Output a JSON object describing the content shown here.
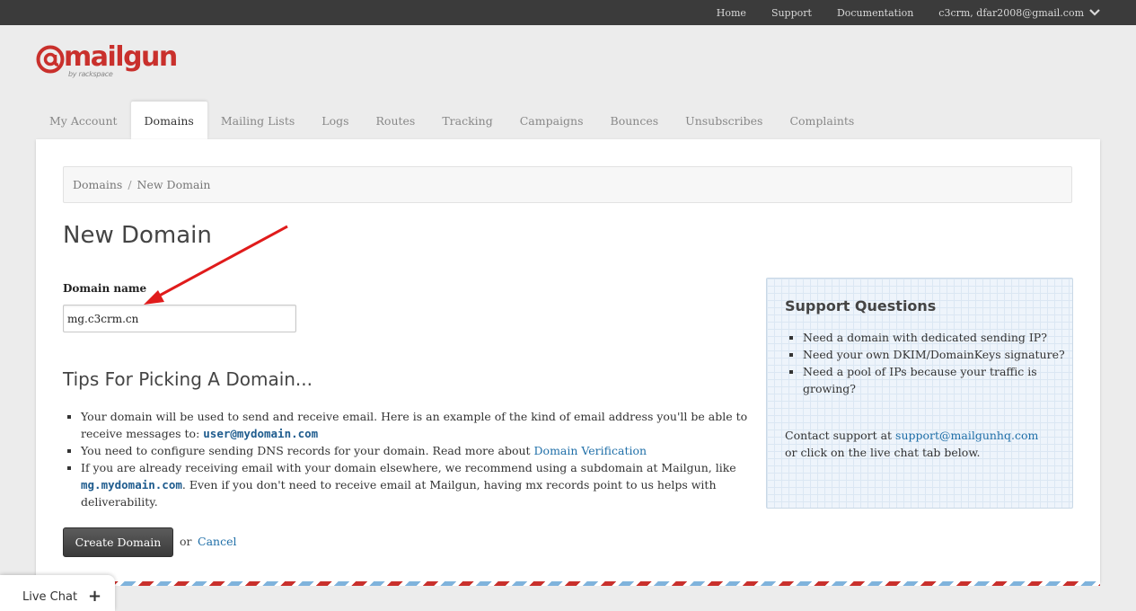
{
  "topnav": {
    "home": "Home",
    "support": "Support",
    "documentation": "Documentation",
    "account": "c3crm, dfar2008@gmail.com"
  },
  "logo": {
    "word": "mailgun",
    "sub": "by rackspace"
  },
  "tabs": [
    {
      "label": "My Account",
      "active": false
    },
    {
      "label": "Domains",
      "active": true
    },
    {
      "label": "Mailing Lists",
      "active": false
    },
    {
      "label": "Logs",
      "active": false
    },
    {
      "label": "Routes",
      "active": false
    },
    {
      "label": "Tracking",
      "active": false
    },
    {
      "label": "Campaigns",
      "active": false
    },
    {
      "label": "Bounces",
      "active": false
    },
    {
      "label": "Unsubscribes",
      "active": false
    },
    {
      "label": "Complaints",
      "active": false
    }
  ],
  "breadcrumb": {
    "root": "Domains",
    "separator": "/",
    "current": "New Domain"
  },
  "page_title": "New Domain",
  "form": {
    "domain_label": "Domain name",
    "domain_value": "mg.c3crm.cn"
  },
  "tips": {
    "title": "Tips For Picking A Domain...",
    "item1_text": "Your domain will be used to send and receive email. Here is an example of the kind of email address you'll be able to receive messages to: ",
    "item1_code": "user@mydomain.com",
    "item2_text": "You need to configure sending DNS records for your domain. Read more about ",
    "item2_link": "Domain Verification",
    "item3_text_a": "If you are already receiving email with your domain elsewhere, we recommend using a subdomain at Mailgun, like ",
    "item3_code": "mg.mydomain.com",
    "item3_text_b": ". Even if you don't need to receive email at Mailgun, having mx records point to us helps with deliverability."
  },
  "actions": {
    "create_label": "Create Domain",
    "or_text": "or",
    "cancel_label": "Cancel"
  },
  "support_box": {
    "title": "Support Questions",
    "items": [
      "Need a domain with dedicated sending IP?",
      "Need your own DKIM/DomainKeys signature?",
      "Need a pool of IPs because your traffic is growing?"
    ],
    "contact_prefix": "Contact support at ",
    "contact_email": "support@mailgunhq.com",
    "contact_suffix": "or click on the live chat tab below."
  },
  "livechat": {
    "label": "Live Chat",
    "plus": "+"
  },
  "colors": {
    "brand_red": "#c9302c",
    "link_blue": "#1f6fa8",
    "topbar": "#3b3b3b",
    "arrow_red": "#e01b1b"
  },
  "icons": {
    "account_menu": "chevron-down-icon",
    "logo_mark": "at-sign-logo-icon"
  }
}
